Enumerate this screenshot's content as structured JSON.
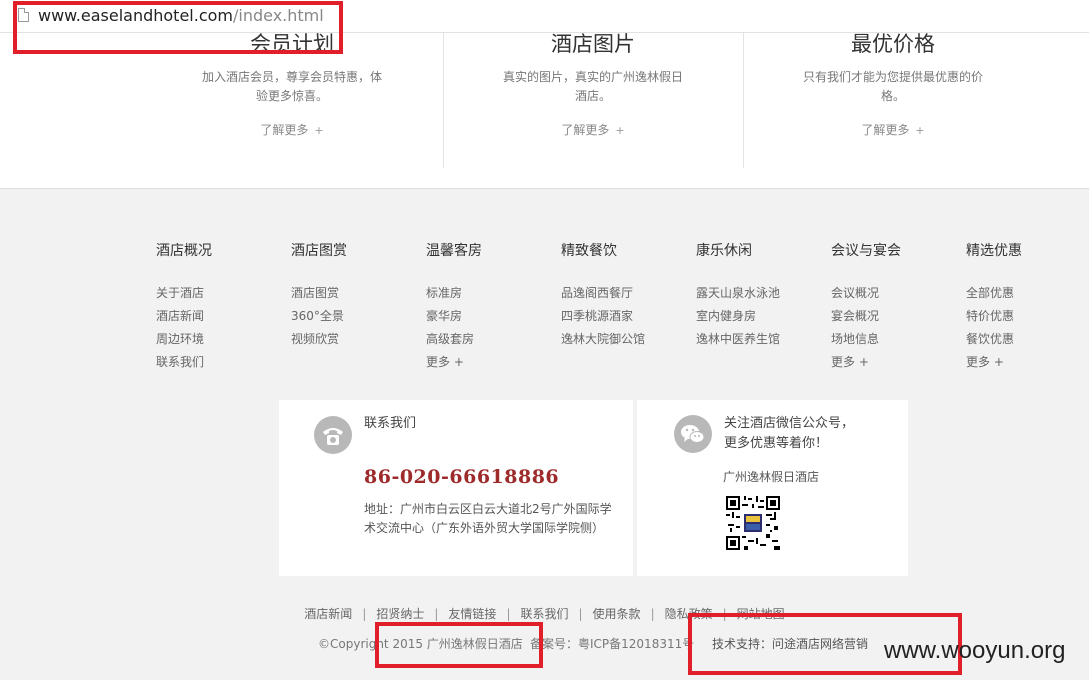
{
  "address_bar": {
    "host": "www.easelandhotel.com",
    "path": "/index.html"
  },
  "features": [
    {
      "title": "会员计划",
      "desc": "加入酒店会员，尊享会员特惠，体验更多惊喜。",
      "more": "了解更多",
      "plus": "+"
    },
    {
      "title": "酒店图片",
      "desc": "真实的图片，真实的广州逸林假日酒店。",
      "more": "了解更多",
      "plus": "+"
    },
    {
      "title": "最优价格",
      "desc": "只有我们才能为您提供最优惠的价格。",
      "more": "了解更多",
      "plus": "+"
    }
  ],
  "nav_columns": [
    {
      "head": "酒店概况",
      "links": [
        "关于酒店",
        "酒店新闻",
        "周边环境",
        "联系我们"
      ]
    },
    {
      "head": "酒店图赏",
      "links": [
        "酒店图赏",
        "360°全景",
        "视频欣赏"
      ]
    },
    {
      "head": "温馨客房",
      "links": [
        "标准房",
        "豪华房",
        "高级套房",
        "更多 +"
      ]
    },
    {
      "head": "精致餐饮",
      "links": [
        "品逸阁西餐厅",
        "四季桃源酒家",
        "逸林大院御公馆"
      ]
    },
    {
      "head": "康乐休闲",
      "links": [
        "露天山泉水泳池",
        "室内健身房",
        "逸林中医养生馆"
      ]
    },
    {
      "head": "会议与宴会",
      "links": [
        "会议概况",
        "宴会概况",
        "场地信息",
        "更多 +"
      ]
    },
    {
      "head": "精选优惠",
      "links": [
        "全部优惠",
        "特价优惠",
        "餐饮优惠",
        "更多 +"
      ]
    }
  ],
  "contact": {
    "title": "联系我们",
    "phone": "86-020-66618886",
    "address": "地址：广州市白云区白云大道北2号广外国际学术交流中心（广东外语外贸大学国际学院侧）"
  },
  "wechat": {
    "title_line1": "关注酒店微信公众号，",
    "title_line2": "更多优惠等着你！",
    "name": "广州逸林假日酒店"
  },
  "bottom_links": [
    "酒店新闻",
    "招贤纳士",
    "友情链接",
    "联系我们",
    "使用条款",
    "隐私政策",
    "网站地图"
  ],
  "bottom_sep": "|",
  "copyright": "©Copyright 2015 广州逸林假日酒店",
  "icp": "备案号：粤ICP备12018311号",
  "support": "技术支持：问途酒店网络营销",
  "watermark": "www.wooyun.org",
  "colors": {
    "highlight": "#e01f2a",
    "phone": "#9e2b2b",
    "footer_bg": "#f2f2f2"
  },
  "icons": [
    "page-icon",
    "phone-icon",
    "wechat-icon",
    "qr-code"
  ]
}
